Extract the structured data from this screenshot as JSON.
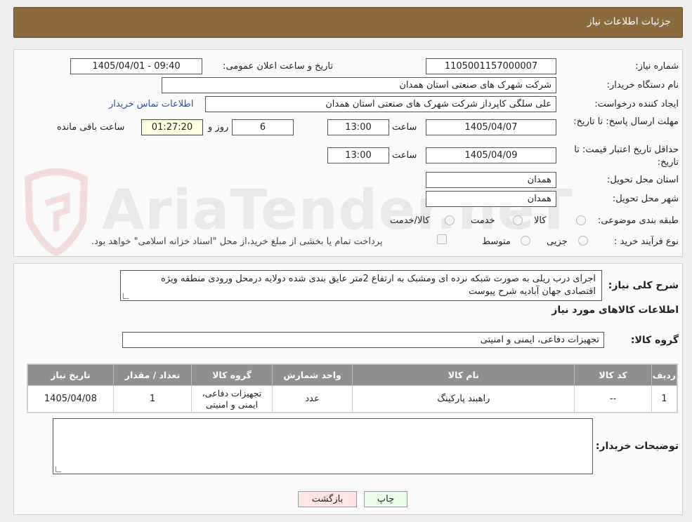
{
  "header": {
    "title": "جزئیات اطلاعات نیاز"
  },
  "watermark": {
    "text": "AriaTender.neT"
  },
  "form": {
    "need_number_label": "شماره نیاز:",
    "need_number": "1105001157000007",
    "announce_label": "تاریخ و ساعت اعلان عمومی:",
    "announce_value": "1405/04/01 - 09:40",
    "buyer_org_label": "نام دستگاه خریدار:",
    "buyer_org": "شرکت شهرک های صنعتی استان همدان",
    "requester_label": "ایجاد کننده درخواست:",
    "requester": "علی سلگی کاپرداز شرکت شهرک های صنعتی استان همدان",
    "contact_link": "اطلاعات تماس خریدار",
    "deadline_label": "مهلت ارسال پاسخ: تا تاریخ:",
    "deadline_date": "1405/04/07",
    "time_label": "ساعت",
    "deadline_time": "13:00",
    "days_value": "6",
    "days_label": "روز و",
    "remaining_time": "01:27:20",
    "remaining_label": "ساعت باقی مانده",
    "validity_label": "حداقل تاریخ اعتبار قیمت: تا تاریخ:",
    "validity_date": "1405/04/09",
    "validity_time": "13:00",
    "province_label": "استان محل تحویل:",
    "province": "همدان",
    "city_label": "شهر محل تحویل:",
    "city": "همدان",
    "category_label": "طبقه بندی موضوعی:",
    "category_options": [
      "کالا",
      "خدمت",
      "کالا/خدمت"
    ],
    "process_label": "نوع فرآیند خرید :",
    "process_options": [
      "جزیی",
      "متوسط"
    ],
    "payment_note": "پرداخت تمام یا بخشی از مبلغ خرید،از محل \"اسناد خزانه اسلامی\" خواهد بود."
  },
  "details": {
    "description_label": "شرح کلی نیاز:",
    "description": "اجرای درب ریلی به صورت شبکه نرده ای ومشبک به ارتفاع 2متر عایق بندی شده دولایه درمحل ورودی منطقه ویژه اقتصادی جهان آبادیه شرح پیوست",
    "goods_info_title": "اطلاعات کالاهای مورد نیاز",
    "goods_group_label": "گروه کالا:",
    "goods_group": "تجهیزات دفاعی، ایمنی و امنیتی"
  },
  "table": {
    "headers": [
      "ردیف",
      "کد کالا",
      "نام کالا",
      "واحد شمارش",
      "گروه کالا",
      "تعداد / مقدار",
      "تاریخ نیاز"
    ],
    "rows": [
      [
        "1",
        "--",
        "راهبند پارکینگ",
        "عدد",
        "تجهیزات دفاعی، ایمنی و امنیتی",
        "1",
        "1405/04/08"
      ]
    ]
  },
  "buyer_notes": {
    "label": "توضیحات خریدار:",
    "value": ""
  },
  "buttons": {
    "print": "چاپ",
    "back": "بازگشت"
  },
  "colors": {
    "header_bg": "#8b6a3e",
    "back_btn_bg": "#ffe4e4",
    "print_btn_bg": "#eaffea",
    "table_header_bg": "#8f8f8f"
  }
}
